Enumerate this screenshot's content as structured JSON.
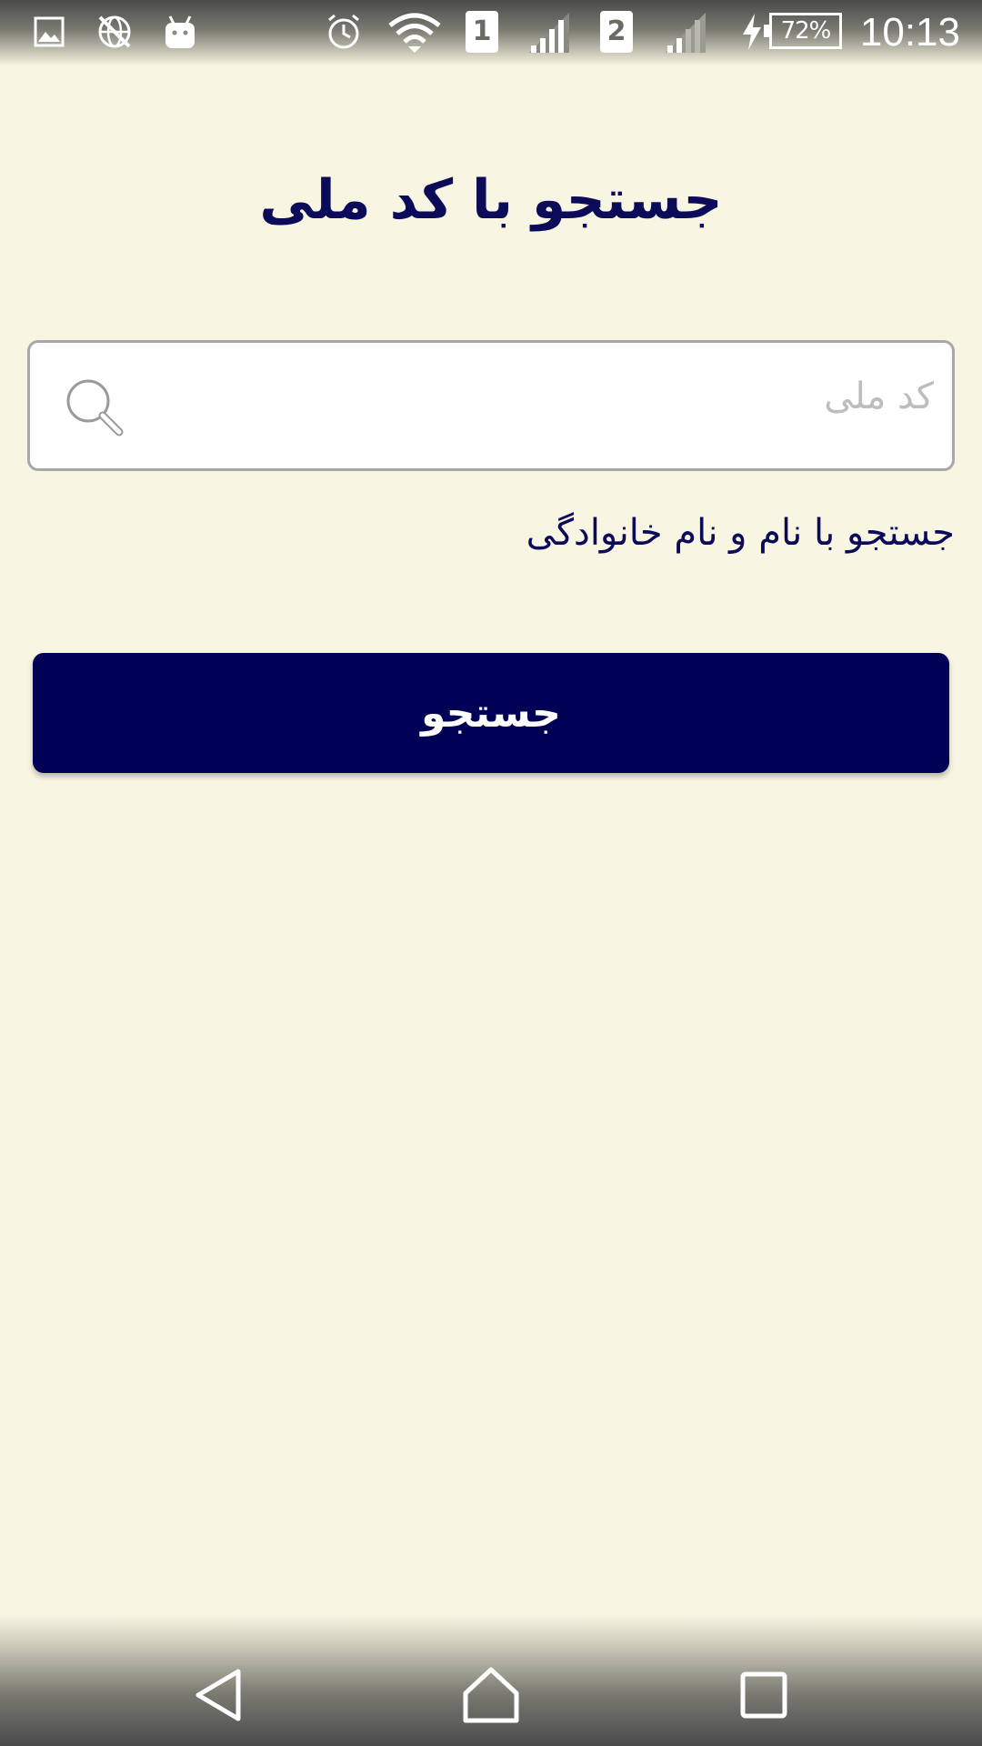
{
  "status_bar": {
    "sim1_label": "1",
    "sim2_label": "2",
    "battery_text": "72%",
    "battery_level": 0.72,
    "time": "10:13",
    "icons": [
      "image-icon",
      "no-network-icon",
      "android-icon",
      "alarm-icon",
      "wifi-icon",
      "signal-icon",
      "signal-weak-icon",
      "charging-icon",
      "battery-icon"
    ]
  },
  "page": {
    "title": "جستجو با کد ملی"
  },
  "search": {
    "placeholder": "کد ملی",
    "value": "",
    "icon": "search-icon"
  },
  "alt_link": {
    "label": "جستجو با نام و نام خانوادگی"
  },
  "actions": {
    "search_button_label": "جستجو"
  },
  "nav_bar": {
    "buttons": [
      "back-icon",
      "home-icon",
      "recents-icon"
    ]
  },
  "colors": {
    "background": "#f9f5e3",
    "primary": "#000055",
    "title_text": "#0b0b5a",
    "placeholder": "#bdbdbd",
    "input_border": "#a8a8a8"
  }
}
